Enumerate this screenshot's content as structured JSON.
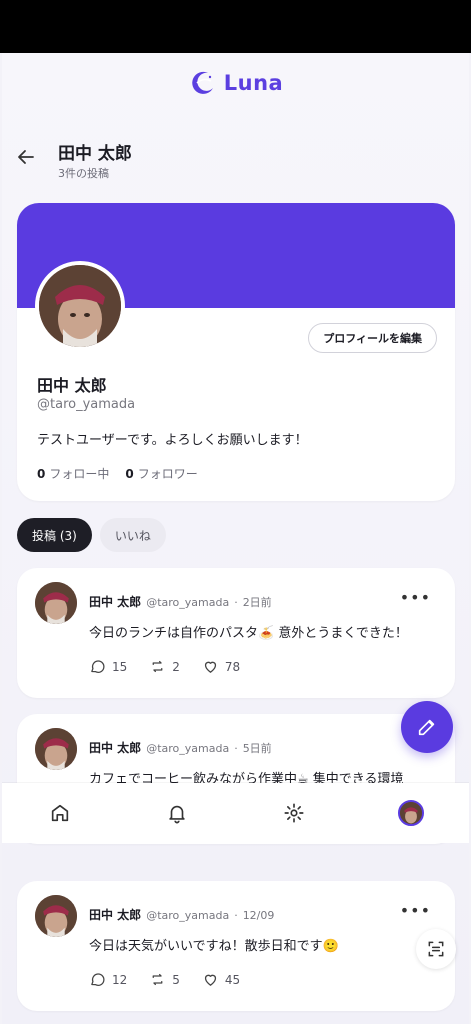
{
  "app": {
    "name": "Luna",
    "brand_color": "#5a3be0"
  },
  "topbar": {
    "title": "田中 太郎",
    "post_count": "3件の投稿"
  },
  "profile": {
    "name": "田中 太郎",
    "handle": "@taro_yamada",
    "bio": "テストユーザーです。よろしくお願いします！",
    "edit_label": "プロフィールを編集",
    "following_count": "0",
    "following_label": "フォロー中",
    "followers_count": "0",
    "followers_label": "フォロワー"
  },
  "tabs": [
    {
      "label": "投稿 (3)",
      "active": true
    },
    {
      "label": "いいね",
      "active": false
    }
  ],
  "posts": [
    {
      "name": "田中 太郎",
      "handle": "@taro_yamada",
      "time": "2日前",
      "text": "今日のランチは自作のパスタ🍝 意外とうまくできた！",
      "replies": "15",
      "reposts": "2",
      "likes": "78"
    },
    {
      "name": "田中 太郎",
      "handle": "@taro_yamada",
      "time": "5日前",
      "text": "カフェでコーヒー飲みながら作業中☕ 集中できる環境",
      "replies": "",
      "reposts": "",
      "likes": ""
    },
    {
      "name": "田中 太郎",
      "handle": "@taro_yamada",
      "time": "12/09",
      "text": "今日は天気がいいですね！散歩日和です🙂",
      "replies": "12",
      "reposts": "5",
      "likes": "45"
    }
  ],
  "nav": [
    "home-icon",
    "bell-icon",
    "gear-icon",
    "profile-avatar"
  ],
  "icons": {
    "more": "•••"
  }
}
